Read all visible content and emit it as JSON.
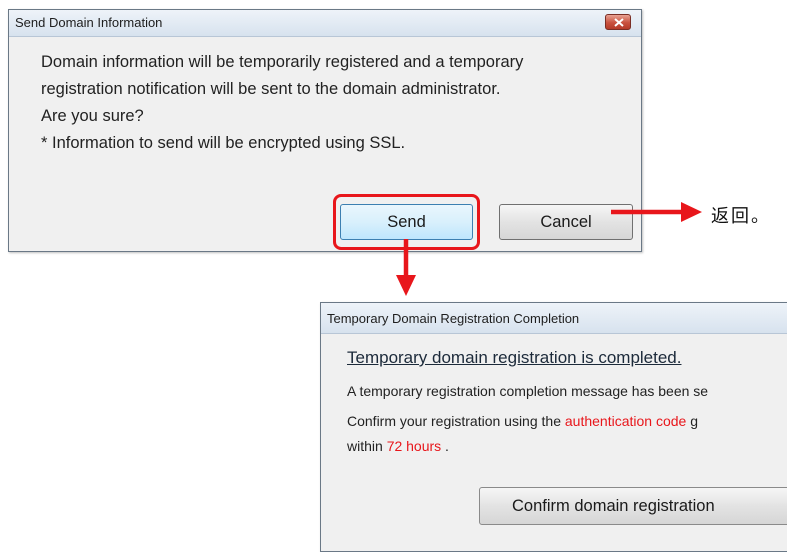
{
  "dialog1": {
    "title": "Send Domain Information",
    "message_line1": "Domain information will be temporarily registered and a temporary",
    "message_line2": "registration notification will be sent to the domain administrator.",
    "message_line3": "Are you sure?",
    "message_line4": "* Information to send will be encrypted using SSL.",
    "send_label": "Send",
    "cancel_label": "Cancel"
  },
  "annotation": {
    "return_note": "返回。",
    "highlight_color": "#e8161b"
  },
  "dialog2": {
    "title": "Temporary Domain Registration Completion",
    "heading": "Temporary domain registration is completed.",
    "line1": "A temporary registration completion message has been se",
    "line2_prefix": "Confirm your registration using the ",
    "line2_red": "authentication code",
    "line2_suffix": " g",
    "line3_prefix": "within ",
    "line3_red": "72 hours",
    "line3_suffix": " .",
    "confirm_label": "Confirm domain registration"
  },
  "icons": {
    "close": "close-icon",
    "arrow": "arrow-icon"
  }
}
